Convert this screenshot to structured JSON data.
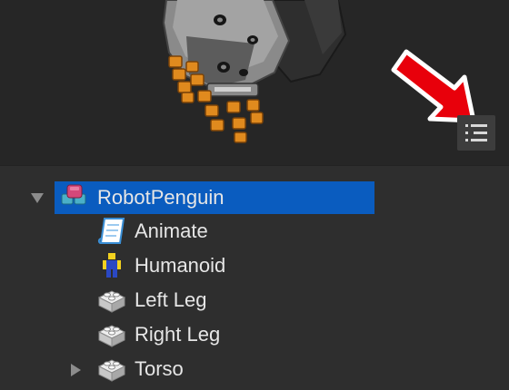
{
  "viewport": {
    "toggle_icon": "list-view-icon"
  },
  "explorer": {
    "root": {
      "label": "RobotPenguin",
      "icon": "model-icon",
      "expanded": true,
      "selected": true
    },
    "children": [
      {
        "label": "Animate",
        "icon": "script-icon"
      },
      {
        "label": "Humanoid",
        "icon": "humanoid-icon"
      },
      {
        "label": "Left Leg",
        "icon": "part-icon"
      },
      {
        "label": "Right Leg",
        "icon": "part-icon"
      },
      {
        "label": "Torso",
        "icon": "part-icon",
        "expandable": true
      }
    ]
  },
  "colors": {
    "selection": "#0a5cbf",
    "annotation_arrow": "#e8000b",
    "text": "#e6e6e6",
    "background": "#2e2e2e"
  }
}
